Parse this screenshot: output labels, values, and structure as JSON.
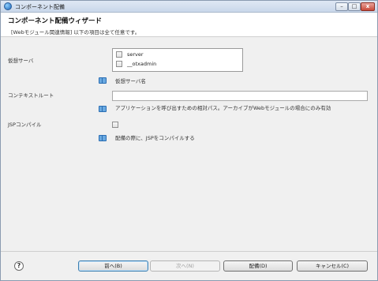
{
  "window": {
    "title": "コンポーネント配備",
    "min_label": "–",
    "max_label": "□",
    "close_label": "x"
  },
  "header": {
    "title": "コンポーネント配備ウィザード",
    "description": "[Webモジュール関連情報] 以下の項目は全て任意です。"
  },
  "virtual_server": {
    "label": "仮想サーバ",
    "options": [
      {
        "name": "server",
        "checked": false
      },
      {
        "name": "__otxadmin",
        "checked": false
      }
    ],
    "hint": "仮想サーバ名"
  },
  "context_root": {
    "label": "コンテキストルート",
    "value": "",
    "hint": "アプリケーションを呼び出すための相対パス。アーカイブがWebモジュールの場合にのみ有効"
  },
  "jsp_compile": {
    "label": "JSPコンパイル",
    "checked": false,
    "hint": "配備の際に、JSPをコンパイルする"
  },
  "footer": {
    "help_label": "?",
    "back_label": "前へ(B)",
    "next_label": "次へ(N)",
    "finish_label": "配備(D)",
    "cancel_label": "キャンセル(C)"
  }
}
